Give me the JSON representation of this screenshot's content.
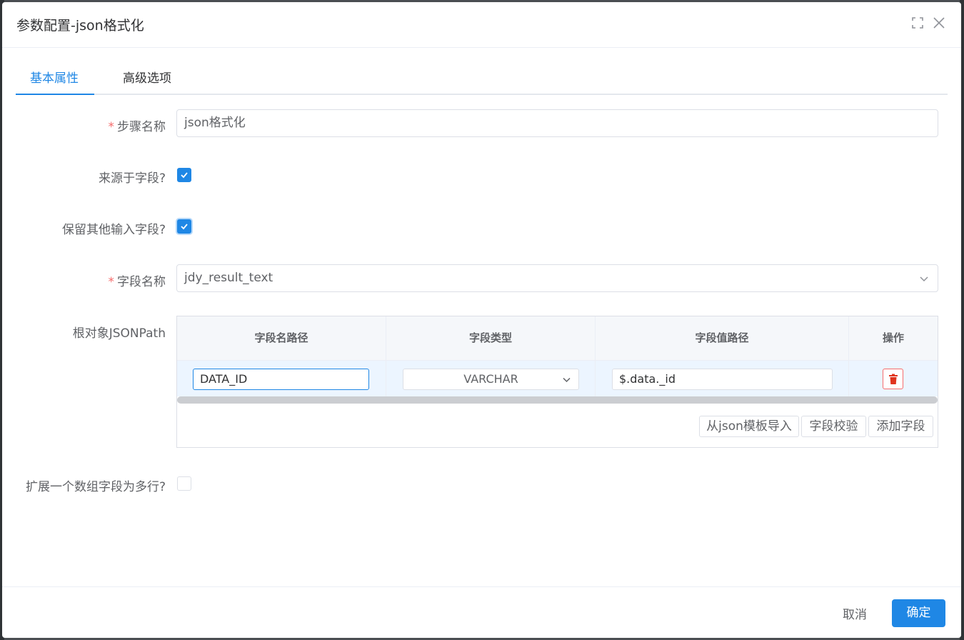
{
  "dialog": {
    "title": "参数配置-json格式化",
    "fullscreen_icon": "fullscreen-icon",
    "close_icon": "close-icon"
  },
  "tabs": [
    {
      "label": "基本属性",
      "active": true
    },
    {
      "label": "高级选项",
      "active": false
    }
  ],
  "form": {
    "step_name": {
      "label": "步骤名称",
      "required": true,
      "value": "json格式化"
    },
    "from_field": {
      "label": "来源于字段?",
      "checked": true
    },
    "keep_input": {
      "label": "保留其他输入字段?",
      "checked": true
    },
    "field_name": {
      "label": "字段名称",
      "required": true,
      "value": "jdy_result_text"
    },
    "root_jsonpath": {
      "label": "根对象JSONPath"
    },
    "expand_array": {
      "label": "扩展一个数组字段为多行?",
      "checked": false
    }
  },
  "table": {
    "columns": [
      "字段名路径",
      "字段类型",
      "字段值路径",
      "操作"
    ],
    "rows": [
      {
        "name_path": "DATA_ID",
        "type": "VARCHAR",
        "value_path": "$.data._id"
      }
    ],
    "buttons": {
      "import": "从json模板导入",
      "validate": "字段校验",
      "add": "添加字段"
    }
  },
  "footer": {
    "cancel": "取消",
    "ok": "确定"
  },
  "colors": {
    "primary": "#1f87e5",
    "danger": "#f56c6c",
    "row_highlight": "#ecf5ff"
  }
}
